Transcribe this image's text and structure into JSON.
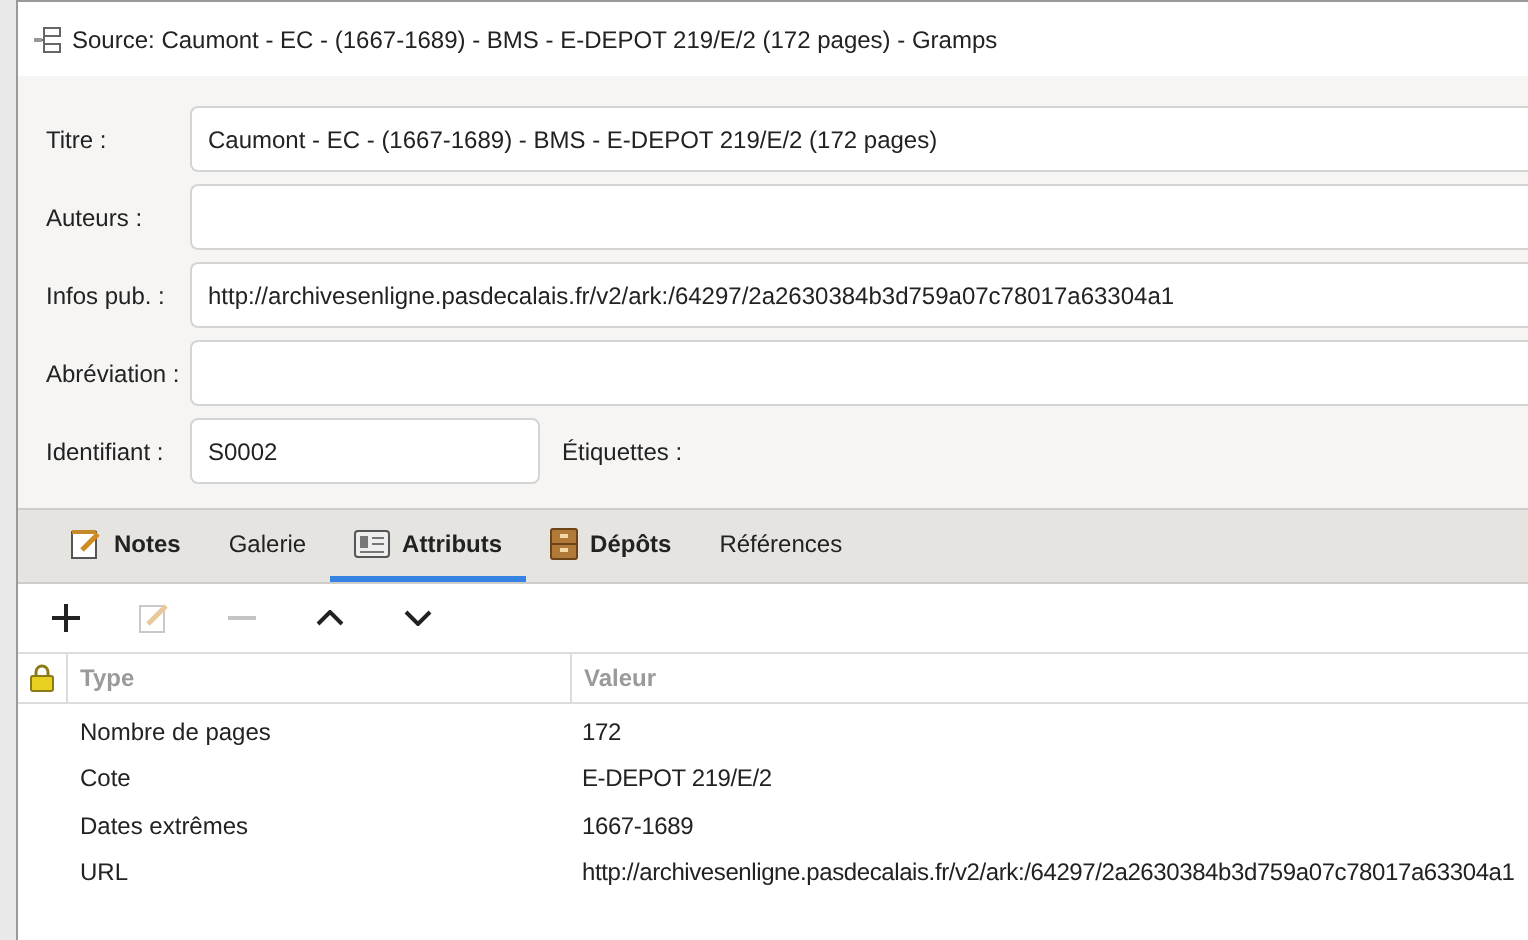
{
  "window": {
    "title": "Source: Caumont - EC - (1667-1689) - BMS - E-DEPOT 219/E/2 (172 pages) - Gramps"
  },
  "form": {
    "fields": [
      {
        "label": "Titre :",
        "value": "Caumont - EC - (1667-1689) - BMS - E-DEPOT 219/E/2 (172 pages)"
      },
      {
        "label": "Auteurs :"
      },
      {
        "label": "Infos pub. :",
        "value": "http://archivesenligne.pasdecalais.fr/v2/ark:/64297/2a2630384b3d759a07c78017a63304a1"
      },
      {
        "label": "Abréviation :"
      }
    ],
    "id_label": "Identifiant :",
    "id_value": "S0002",
    "tags_label": "Étiquettes :"
  },
  "tabs": [
    {
      "label": "Notes",
      "kind": "notes",
      "has_content": true,
      "selected": false
    },
    {
      "label": "Galerie",
      "has_content": false,
      "selected": false
    },
    {
      "label": "Attributs",
      "kind": "attributes",
      "has_content": true,
      "selected": true
    },
    {
      "label": "Dépôts",
      "kind": "repositories",
      "has_content": true,
      "selected": false
    },
    {
      "label": "Références",
      "has_content": false,
      "selected": false
    }
  ],
  "toolbar": [
    {
      "kind": "add",
      "disabled": false
    },
    {
      "kind": "edit",
      "disabled": true
    },
    {
      "kind": "remove",
      "disabled": true
    },
    {
      "kind": "up",
      "disabled": false
    },
    {
      "kind": "down",
      "disabled": false
    }
  ],
  "table": {
    "columns": [
      "Type",
      "Valeur"
    ],
    "rows": [
      {
        "type": "Nombre de pages",
        "value": "172"
      },
      {
        "type": "Cote",
        "value": "E-DEPOT 219/E/2"
      },
      {
        "type": "Dates extrêmes",
        "value": "1667-1689"
      },
      {
        "type": "URL",
        "value": "http://archivesenligne.pasdecalais.fr/v2/ark:/64297/2a2630384b3d759a07c78017a63304a1"
      }
    ]
  }
}
